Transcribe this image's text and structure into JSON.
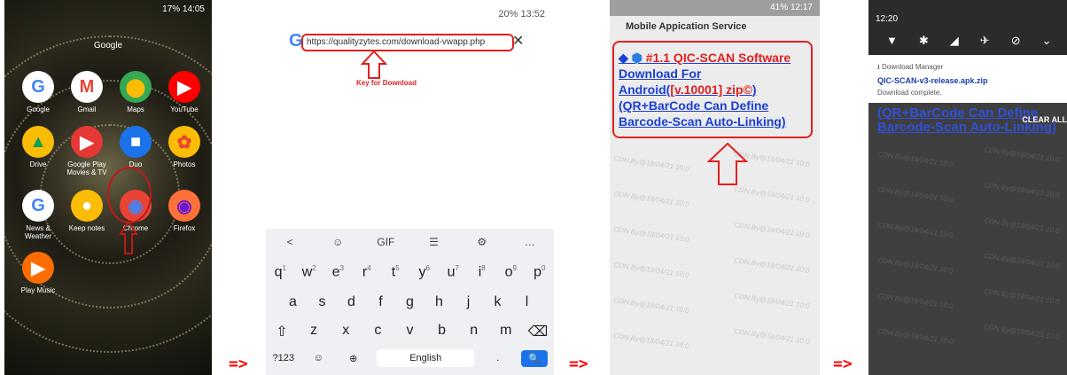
{
  "separator": "=>",
  "panel1": {
    "status": "17%  14:05",
    "folder_label": "Google",
    "apps": [
      {
        "name": "google-app",
        "label": "Google",
        "glyph": "G",
        "color": "#ffffff",
        "fg": "#4285f4"
      },
      {
        "name": "gmail-app",
        "label": "Gmail",
        "glyph": "M",
        "color": "#ffffff",
        "fg": "#ea4335"
      },
      {
        "name": "maps-app",
        "label": "Maps",
        "glyph": "⬤",
        "color": "#34a853",
        "fg": "#fbbc05"
      },
      {
        "name": "youtube-app",
        "label": "YouTube",
        "glyph": "▶",
        "color": "#ff0000",
        "fg": "#ffffff"
      },
      {
        "name": "drive-app",
        "label": "Drive",
        "glyph": "▲",
        "color": "#fbbc05",
        "fg": "#0f9d58"
      },
      {
        "name": "play-movies-app",
        "label": "Google Play Movies & TV",
        "glyph": "▶",
        "color": "#e53935",
        "fg": "#ffffff"
      },
      {
        "name": "duo-app",
        "label": "Duo",
        "glyph": "■",
        "color": "#1a73e8",
        "fg": "#ffffff"
      },
      {
        "name": "photos-app",
        "label": "Photos",
        "glyph": "✿",
        "color": "#fbbc05",
        "fg": "#ea4335"
      },
      {
        "name": "news-app",
        "label": "News & Weather",
        "glyph": "G",
        "color": "#ffffff",
        "fg": "#4285f4"
      },
      {
        "name": "keep-app",
        "label": "Keep notes",
        "glyph": "●",
        "color": "#fbbc05",
        "fg": "#ffffff"
      },
      {
        "name": "chrome-app",
        "label": "Chrome",
        "glyph": "◉",
        "color": "#ea4335",
        "fg": "#4285f4"
      },
      {
        "name": "firefox-app",
        "label": "Firefox",
        "glyph": "◉",
        "color": "#ff7139",
        "fg": "#6a1bd1"
      },
      {
        "name": "play-music-app",
        "label": "Play Music",
        "glyph": "▶",
        "color": "#ff6d00",
        "fg": "#ffffff"
      }
    ]
  },
  "panel2": {
    "status": "20%  13:52",
    "url": "https://qualityzytes.com/download-vwapp.php",
    "key_label": "Key for Download",
    "toolbar": [
      "<",
      "☺",
      "GIF",
      "☰",
      "⚙",
      "…"
    ],
    "row1": [
      [
        "q",
        "1"
      ],
      [
        "w",
        "2"
      ],
      [
        "e",
        "3"
      ],
      [
        "r",
        "4"
      ],
      [
        "t",
        "5"
      ],
      [
        "y",
        "6"
      ],
      [
        "u",
        "7"
      ],
      [
        "i",
        "8"
      ],
      [
        "o",
        "9"
      ],
      [
        "p",
        "0"
      ]
    ],
    "row2": [
      "a",
      "s",
      "d",
      "f",
      "g",
      "h",
      "j",
      "k",
      "l"
    ],
    "row3": [
      "⇧",
      "z",
      "x",
      "c",
      "v",
      "b",
      "n",
      "m",
      "⌫"
    ],
    "row4": [
      "?123",
      "☺",
      "⊕",
      "English",
      ".",
      "🔍"
    ]
  },
  "panel3": {
    "status": "41%  12:17",
    "title": "Mobile Appication Service",
    "link_line1": "#1.1 QIC-SCAN Software",
    "link_line2": "Download For",
    "link_line3a": "Android(",
    "link_line3b": "[v.10001] zip©",
    "link_line3c": ")",
    "link_line4": "(QR+BarCode Can Define",
    "link_line5": "Barcode-Scan Auto-Linking)",
    "watermark": "CDN.By@18/04/21 10:0"
  },
  "panel4": {
    "time": "12:20",
    "source": "Download Manager",
    "filename": "QIC-SCAN-v3-release.apk.zip",
    "status": "Download complete.",
    "bg_line1": "(QR+BarCode Can Define",
    "bg_line2": "Barcode-Scan Auto-Linking)",
    "clear_all": "CLEAR ALL",
    "watermark": "CDN.By@18/04/21 10:0"
  }
}
